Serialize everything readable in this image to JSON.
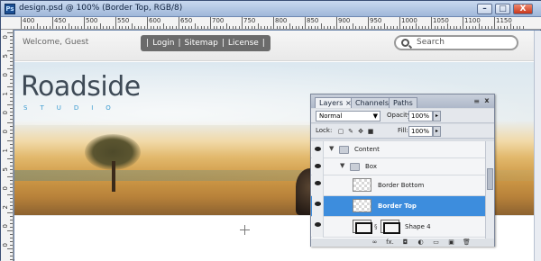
{
  "window": {
    "app_badge": "Ps",
    "title": "design.psd @ 100% (Border Top, RGB/8)",
    "minimize": "–",
    "maximize": "□",
    "close": "X"
  },
  "ruler": {
    "top_labels": [
      "400",
      "450",
      "500",
      "550",
      "600",
      "650",
      "700",
      "750",
      "800",
      "850",
      "900",
      "950",
      "1000",
      "1050",
      "1100",
      "1150"
    ],
    "left_labels": [
      "0",
      "5",
      "0",
      "1",
      "0",
      "0",
      "1",
      "5",
      "0",
      "2",
      "0",
      "0"
    ]
  },
  "site": {
    "welcome": "Welcome, Guest",
    "nav": [
      "|",
      "Login",
      "|",
      "Sitemap",
      "|",
      "License",
      "|"
    ],
    "search_placeholder": "Search",
    "logo_title": "Roadside",
    "logo_sub": "STUDIO"
  },
  "layers_panel": {
    "tabs": [
      "Layers",
      "Channels",
      "Paths"
    ],
    "tab_close": "×",
    "menu_icon": "≡",
    "close_icon": "x",
    "blend_mode": "Normal",
    "opacity_label": "Opacity:",
    "opacity_value": "100%",
    "lock_label": "Lock:",
    "fill_label": "Fill:",
    "fill_value": "100%",
    "layers": [
      {
        "name": "Content",
        "type": "group",
        "expanded": true,
        "indent": 0,
        "selected": false
      },
      {
        "name": "Box",
        "type": "group",
        "expanded": true,
        "indent": 1,
        "selected": false
      },
      {
        "name": "Border Bottom",
        "type": "layer",
        "indent": 2,
        "selected": false
      },
      {
        "name": "Border Top",
        "type": "layer",
        "indent": 2,
        "selected": true
      },
      {
        "name": "Shape 4",
        "type": "shape",
        "indent": 2,
        "selected": false
      }
    ],
    "footer_icons": [
      "link-icon",
      "fx-icon",
      "mask-icon",
      "adjustment-icon",
      "group-icon",
      "new-layer-icon",
      "trash-icon"
    ],
    "footer_glyphs": [
      "∞",
      "fx.",
      "◘",
      "◐",
      "▭",
      "▣",
      "🗑"
    ]
  },
  "colors": {
    "selection": "#3d8ddd",
    "nav_pill": "#6b6b6b",
    "logo_sub": "#3a9ad0"
  }
}
